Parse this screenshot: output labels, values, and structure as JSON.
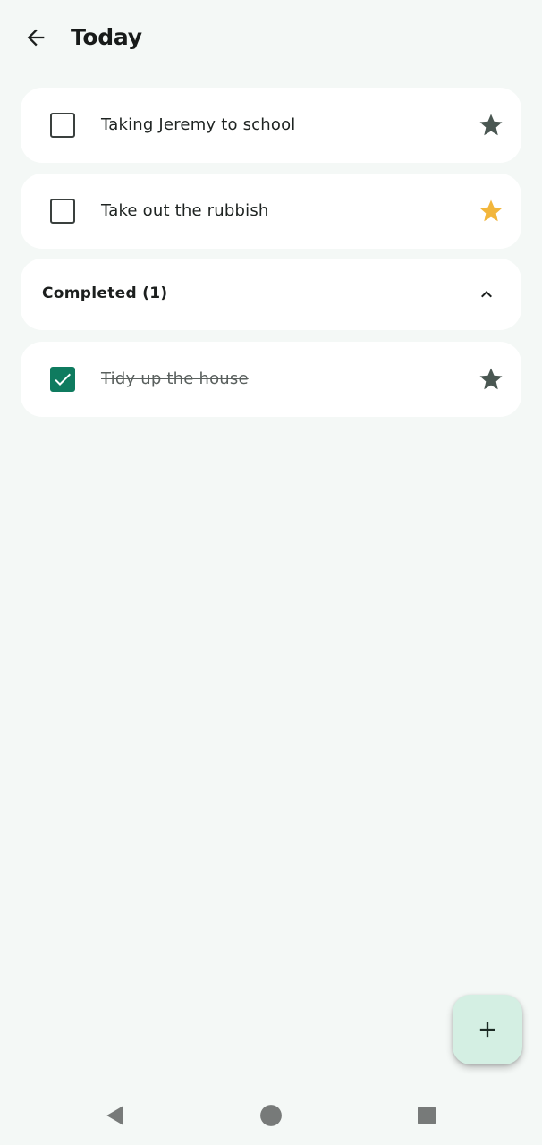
{
  "header": {
    "title": "Today"
  },
  "tasks": [
    {
      "text": "Taking Jeremy to school",
      "checked": false,
      "starred": false
    },
    {
      "text": "Take out the rubbish",
      "checked": false,
      "starred": true
    }
  ],
  "completed_section": {
    "label": "Completed (1)",
    "expanded": true
  },
  "completed_tasks": [
    {
      "text": "Tidy up the house",
      "checked": true,
      "starred": false
    }
  ],
  "colors": {
    "background": "#f4f8f6",
    "accent": "#0f7b5f",
    "star_filled": "#f2b63c",
    "star_default": "#4a5752",
    "fab": "#d4efe3"
  },
  "icons": {
    "back": "arrow-left-icon",
    "star": "star-icon",
    "chevron": "chevron-up-icon",
    "add": "plus-icon",
    "nav_back": "triangle-back-icon",
    "nav_home": "circle-home-icon",
    "nav_recents": "square-recents-icon"
  }
}
